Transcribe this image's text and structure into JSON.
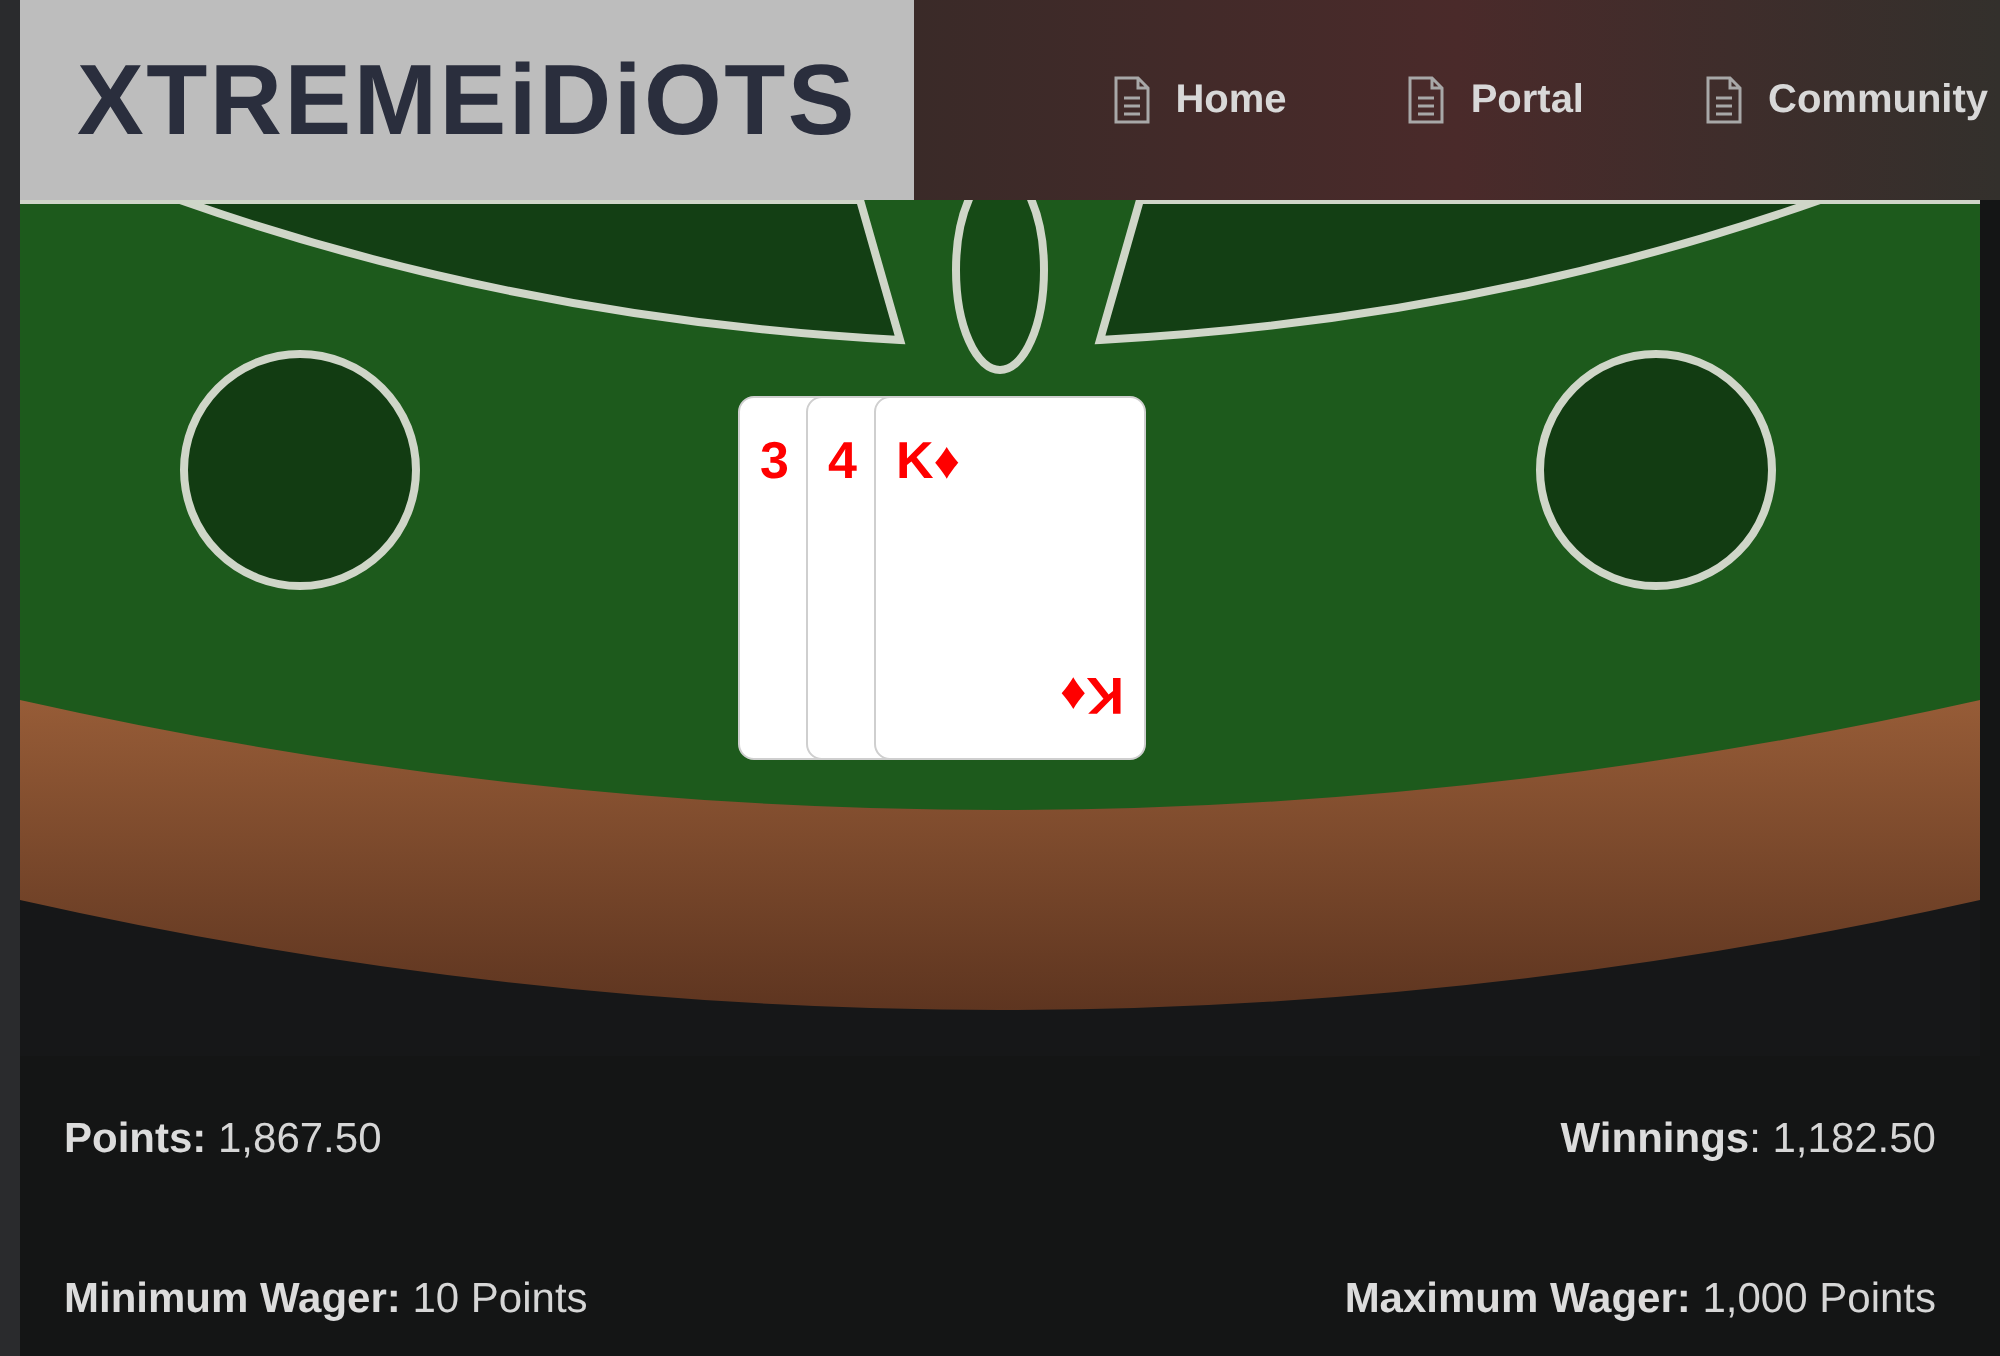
{
  "header": {
    "logo": "XTREMEiDiOTS",
    "nav": [
      {
        "label": "Home"
      },
      {
        "label": "Portal"
      },
      {
        "label": "Community"
      }
    ]
  },
  "cards": [
    {
      "label": "3"
    },
    {
      "label": "4"
    },
    {
      "label": "K♦",
      "bottom_label": "K♦"
    }
  ],
  "stats": [
    {
      "text": "**Points:** 1,867.50"
    },
    {
      "text": "**Winnings**: 1,182.50"
    },
    {
      "text": "**Minimum Wager:** 10 Points"
    },
    {
      "text": "**Maximum Wager:** 1,000 Points"
    }
  ]
}
